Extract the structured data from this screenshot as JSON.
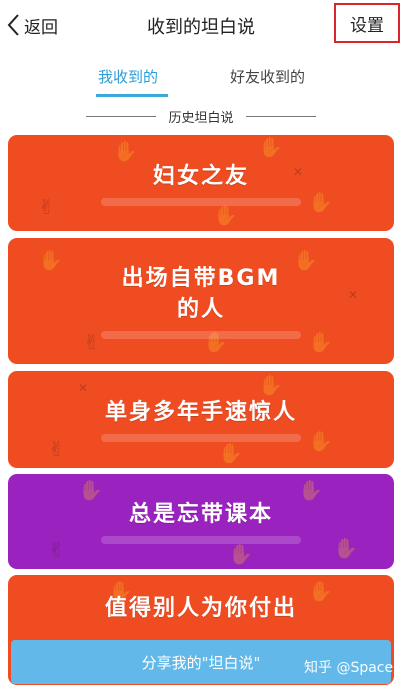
{
  "header": {
    "back_label": "返回",
    "title": "收到的坦白说",
    "settings_label": "设置"
  },
  "tabs": [
    {
      "label": "我收到的",
      "active": true
    },
    {
      "label": "好友收到的",
      "active": false
    }
  ],
  "section": {
    "label": "历史坦白说"
  },
  "cards": [
    {
      "lines": [
        "妇女之友"
      ],
      "color": "#f04c22"
    },
    {
      "lines": [
        "出场自带BGM",
        "的人"
      ],
      "color": "#f04c22"
    },
    {
      "lines": [
        "单身多年手速惊人"
      ],
      "color": "#f04c22"
    },
    {
      "lines": [
        "总是忘带课本"
      ],
      "color": "#9a22bf"
    },
    {
      "lines": [
        "值得别人为你付出"
      ],
      "color": "#f04c22"
    }
  ],
  "share": {
    "label": "分享我的\"坦白说\""
  },
  "watermark": "知乎 @Space",
  "colors": {
    "accent": "#39a9dc",
    "highlight_border": "#d8262b"
  }
}
